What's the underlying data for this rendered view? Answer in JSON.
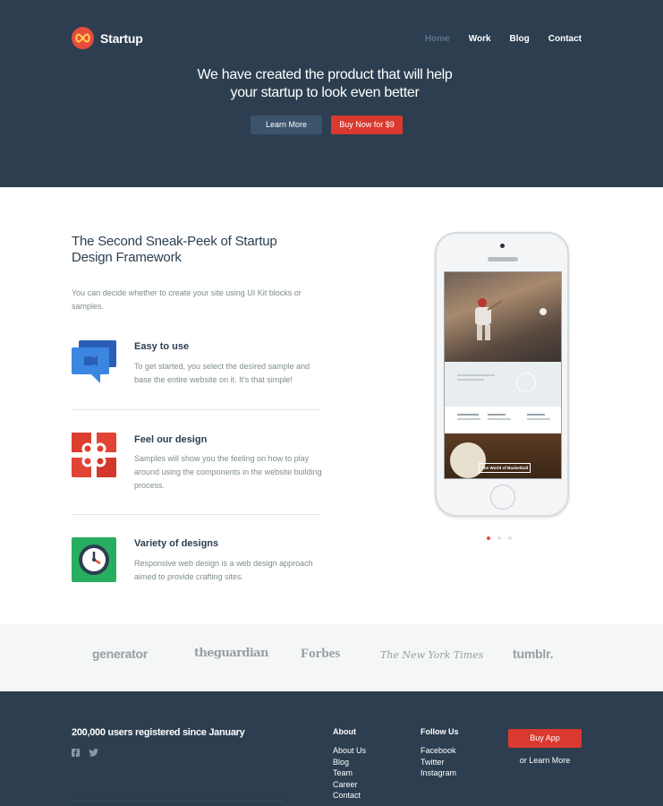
{
  "header": {
    "brand": "Startup",
    "nav": [
      {
        "label": "Home",
        "active": true
      },
      {
        "label": "Work",
        "active": false
      },
      {
        "label": "Blog",
        "active": false
      },
      {
        "label": "Contact",
        "active": false
      }
    ],
    "hero_line1": "We have created the product that will help",
    "hero_line2": "your startup to look even better",
    "learn_more": "Learn More",
    "buy_now": "Buy Now for $9"
  },
  "main": {
    "title_line1": "The Second Sneak-Peek of Startup",
    "title_line2": "Design Framework",
    "lead": "You can decide whether to create your site using UI Kit blocks or samples.",
    "features": [
      {
        "title": "Easy to use",
        "text": "To get started, you select the desired sample and base the entire website on it. It's that simple!",
        "icon": "chat-bubbles-icon"
      },
      {
        "title": "Feel our design",
        "text": "Samples will show you the feeling on how to play around using the components in the website building process.",
        "icon": "gift-icon"
      },
      {
        "title": "Variety of designs",
        "text": "Responsive web design is a web design approach aimed to provide crafting sites.",
        "icon": "clock-icon"
      }
    ],
    "phone_screen_label": "The World of Basketball",
    "carousel": {
      "count": 3,
      "active": 0
    }
  },
  "press": {
    "logos": [
      "generator",
      "theguardian",
      "Forbes",
      "The New York Times",
      "tumblr."
    ]
  },
  "footer": {
    "tagline": "200,000 users registered since January",
    "social_icons": [
      "facebook-icon",
      "twitter-icon"
    ],
    "about": {
      "title": "About",
      "links": [
        "About Us",
        "Blog",
        "Team",
        "Career",
        "Contact"
      ]
    },
    "follow": {
      "title": "Follow Us",
      "links": [
        "Facebook",
        "Twitter",
        "Instagram"
      ]
    },
    "buy_app": "Buy App",
    "or_learn_more": "or Learn More"
  },
  "colors": {
    "navy": "#2c3e50",
    "accent_red": "#d9392e",
    "muted_nav": "#5c7389",
    "button_blue": "#3b536b"
  }
}
